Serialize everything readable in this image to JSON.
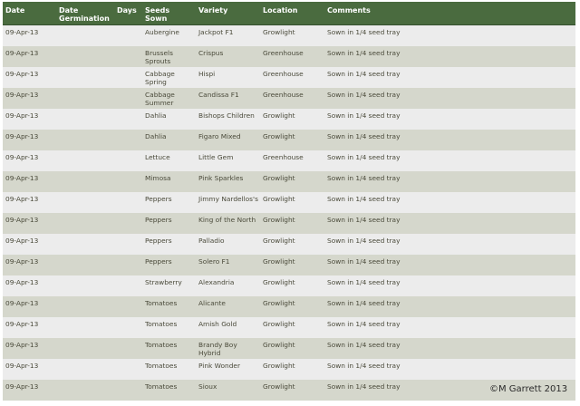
{
  "table": {
    "headers": [
      "Date",
      "Date Germination",
      "Days",
      "Seeds Sown",
      "Variety",
      "Location",
      "Comments"
    ],
    "rows": [
      [
        "09-Apr-13",
        "",
        "",
        "Aubergine",
        "Jackpot F1",
        "Growlight",
        "Sown in 1/4 seed tray"
      ],
      [
        "09-Apr-13",
        "",
        "",
        "Brussels Sprouts",
        "Crispus",
        "Greenhouse",
        "Sown in 1/4 seed tray"
      ],
      [
        "09-Apr-13",
        "",
        "",
        "Cabbage Spring",
        "Hispi",
        "Greenhouse",
        "Sown in 1/4 seed tray"
      ],
      [
        "09-Apr-13",
        "",
        "",
        "Cabbage Summer",
        "Candissa F1",
        "Greenhouse",
        "Sown in 1/4 seed tray"
      ],
      [
        "09-Apr-13",
        "",
        "",
        "Dahlia",
        "Bishops Children",
        "Growlight",
        "Sown in 1/4 seed tray"
      ],
      [
        "09-Apr-13",
        "",
        "",
        "Dahlia",
        "Figaro Mixed",
        "Growlight",
        "Sown in 1/4 seed tray"
      ],
      [
        "09-Apr-13",
        "",
        "",
        "Lettuce",
        "Little Gem",
        "Greenhouse",
        "Sown in 1/4 seed tray"
      ],
      [
        "09-Apr-13",
        "",
        "",
        "Mimosa",
        "Pink Sparkles",
        "Growlight",
        "Sown in 1/4 seed tray"
      ],
      [
        "09-Apr-13",
        "",
        "",
        "Peppers",
        "Jimmy Nardellos's",
        "Growlight",
        "Sown in 1/4 seed tray"
      ],
      [
        "09-Apr-13",
        "",
        "",
        "Peppers",
        "King of the North",
        "Growlight",
        "Sown in 1/4 seed tray"
      ],
      [
        "09-Apr-13",
        "",
        "",
        "Peppers",
        "Palladio",
        "Growlight",
        "Sown in 1/4 seed tray"
      ],
      [
        "09-Apr-13",
        "",
        "",
        "Peppers",
        "Solero F1",
        "Growlight",
        "Sown in 1/4 seed tray"
      ],
      [
        "09-Apr-13",
        "",
        "",
        "Strawberry",
        "Alexandria",
        "Growlight",
        "Sown in 1/4 seed tray"
      ],
      [
        "09-Apr-13",
        "",
        "",
        "Tomatoes",
        "Alicante",
        "Growlight",
        "Sown in 1/4 seed tray"
      ],
      [
        "09-Apr-13",
        "",
        "",
        "Tomatoes",
        "Amish Gold",
        "Growlight",
        "Sown in 1/4 seed tray"
      ],
      [
        "09-Apr-13",
        "",
        "",
        "Tomatoes",
        "Brandy Boy Hybrid",
        "Growlight",
        "Sown in 1/4 seed tray"
      ],
      [
        "09-Apr-13",
        "",
        "",
        "Tomatoes",
        "Pink Wonder",
        "Growlight",
        "Sown in 1/4 seed tray"
      ],
      [
        "09-Apr-13",
        "",
        "",
        "Tomatoes",
        "Sioux",
        "Growlight",
        "Sown in 1/4 seed tray"
      ]
    ]
  },
  "copyright": "©M Garrett 2013",
  "colors": {
    "header_bg": "#4a6b3f",
    "row_light": "#ececec",
    "row_dark": "#d5d7cc"
  }
}
